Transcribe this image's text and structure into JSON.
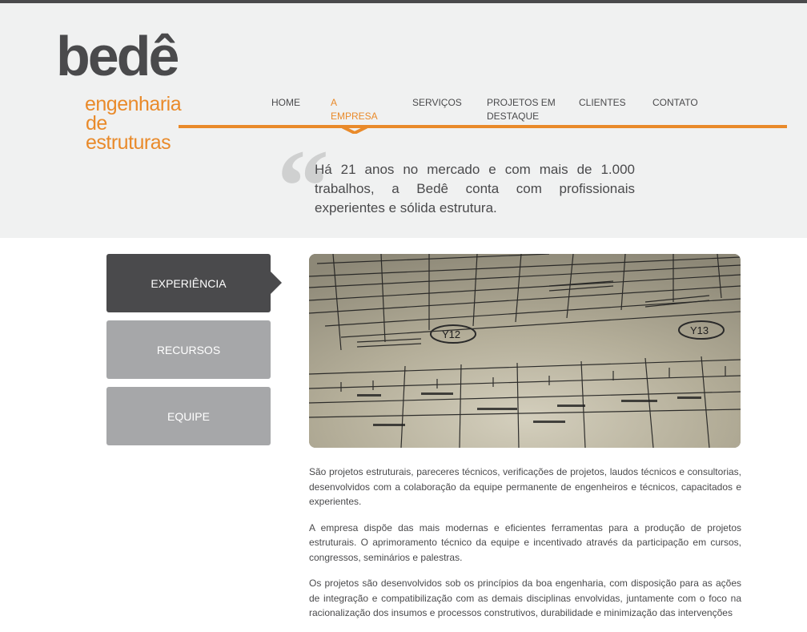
{
  "logo": {
    "main": "bedê",
    "line1": "engenharia",
    "line2": "de estruturas"
  },
  "nav": {
    "items": [
      {
        "label": "HOME"
      },
      {
        "label": "A EMPRESA"
      },
      {
        "label": "SERVIÇOS"
      },
      {
        "label": "PROJETOS EM DESTAQUE"
      },
      {
        "label": "CLIENTES"
      },
      {
        "label": "CONTATO"
      }
    ],
    "active": "A EMPRESA"
  },
  "quote": {
    "mark": "“",
    "text": "Há 21 anos no mercado e com mais de 1.000 trabalhos, a Bedê conta com profissionais experientes e sólida estrutura."
  },
  "tabs": [
    {
      "label": "EXPERIÊNCIA",
      "active": true
    },
    {
      "label": "RECURSOS",
      "active": false
    },
    {
      "label": "EQUIPE",
      "active": false
    }
  ],
  "hero": {
    "labels": [
      "Y12",
      "Y13"
    ]
  },
  "content": {
    "paragraphs": [
      "São projetos estruturais, pareceres técnicos, verificações de projetos, laudos técnicos e consultorias, desenvolvidos com a colaboração da equipe permanente de engenheiros e técnicos, capacitados e experientes.",
      "A empresa dispõe das mais modernas e eficientes ferramentas para a produção de projetos estruturais. O aprimoramento técnico da equipe e incentivado através da participação em cursos, congressos, seminários e palestras.",
      "Os projetos são desenvolvidos sob os princípios da boa engenharia, com disposição para as ações de integração e compatibilização com as demais disciplinas envolvidas, juntamente com o foco na racionalização dos insumos e processos construtivos, durabilidade e minimização das intervenções"
    ]
  },
  "colors": {
    "accent": "#e98a2a",
    "dark": "#4a4a4c",
    "inactive_tab": "#a6a7a9",
    "header_bg": "#f0f1f1"
  }
}
